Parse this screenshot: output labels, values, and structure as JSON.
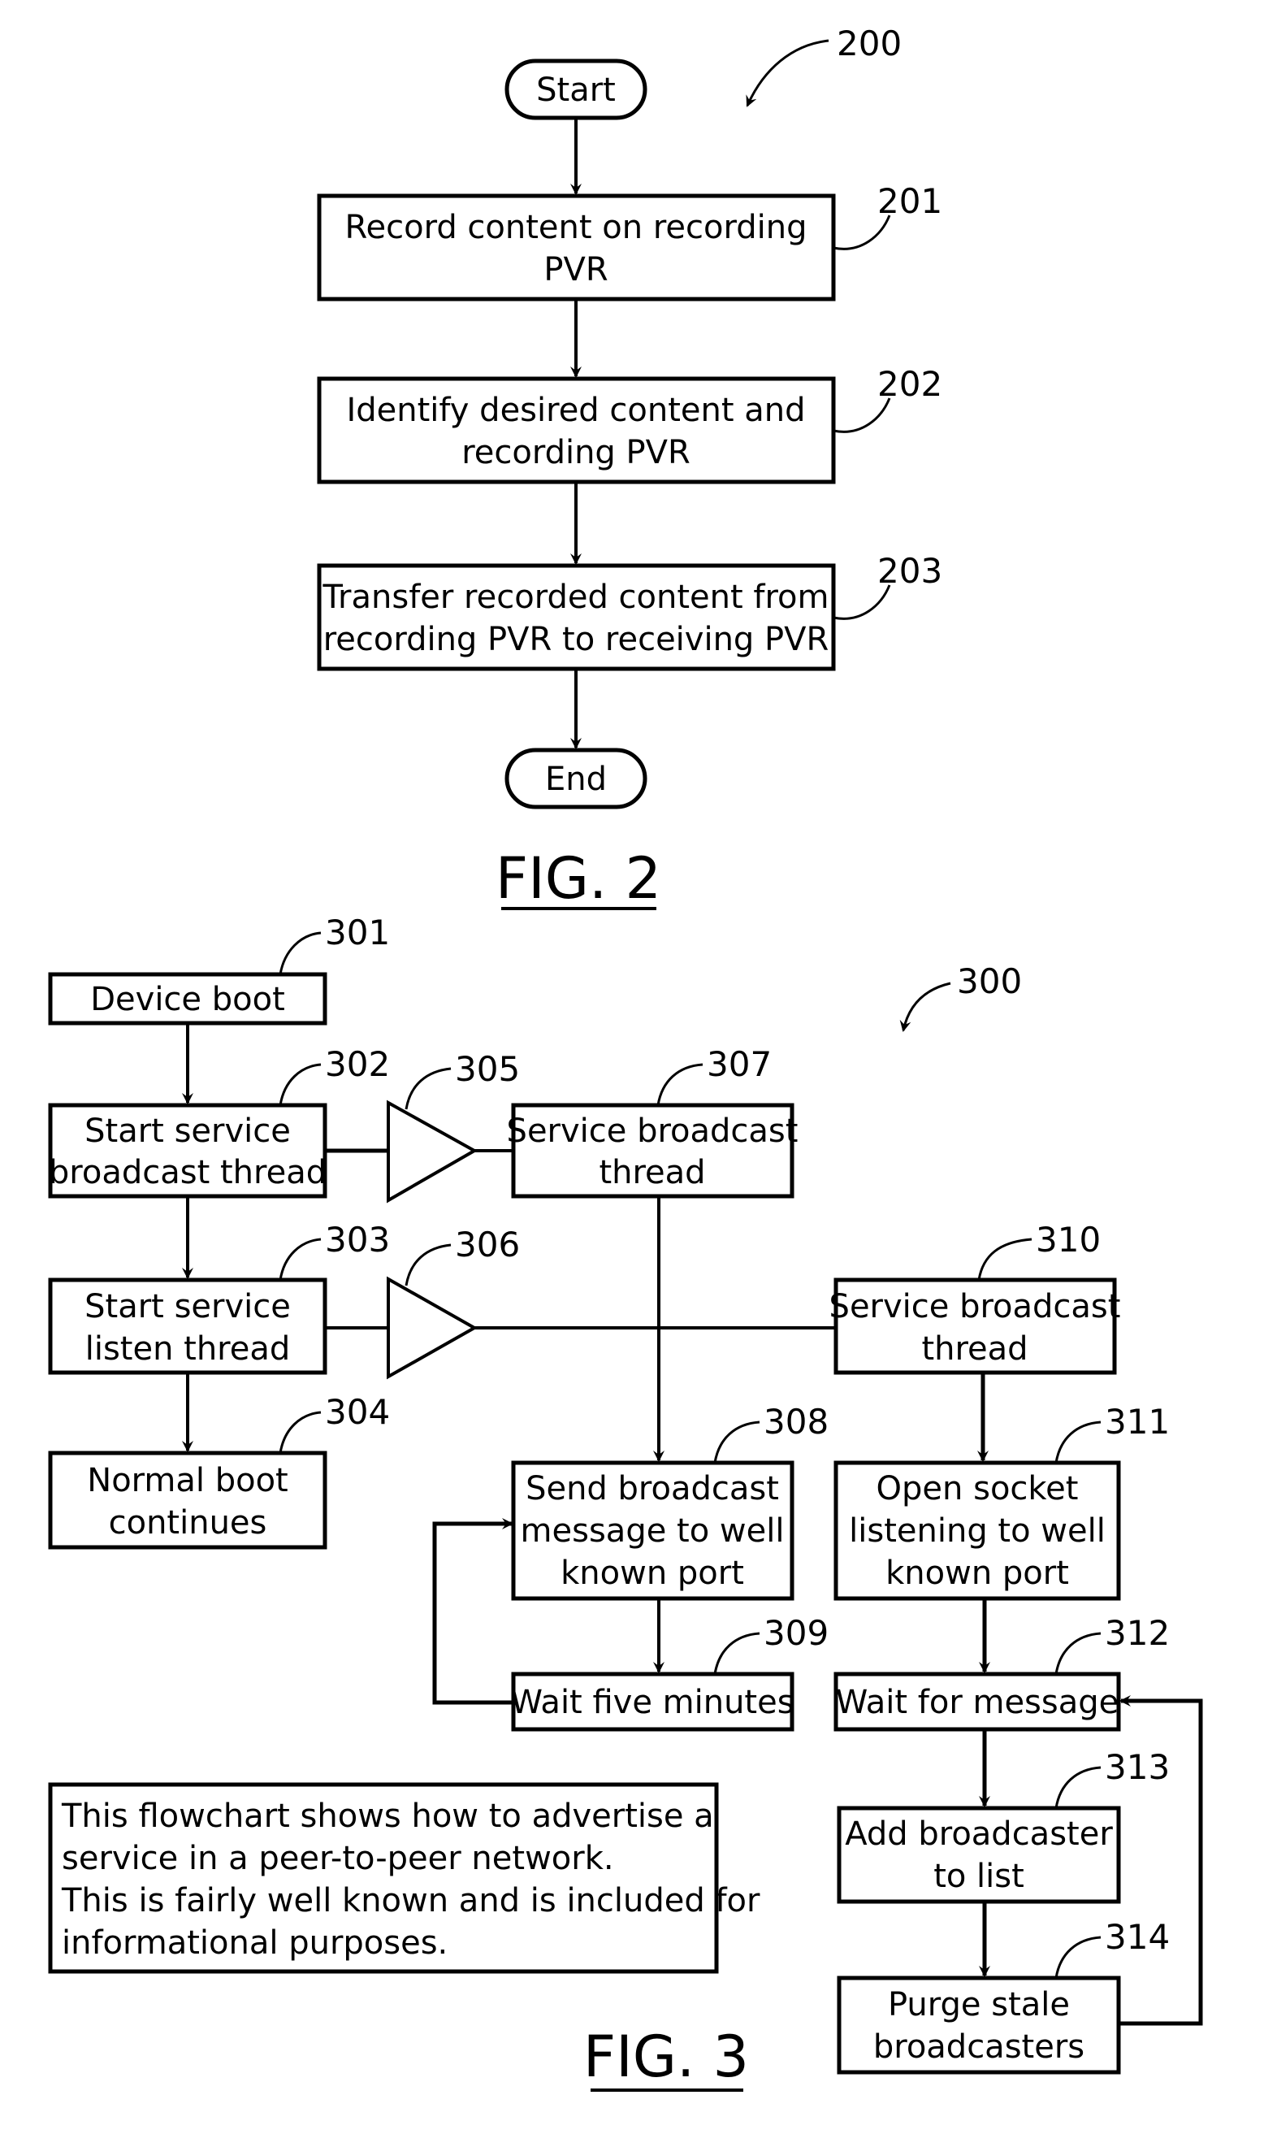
{
  "fig2": {
    "ref": "200",
    "caption": "FIG. 2",
    "start": "Start",
    "end": "End",
    "steps": [
      {
        "ref": "201",
        "lines": [
          "Record content on recording",
          "PVR"
        ]
      },
      {
        "ref": "202",
        "lines": [
          "Identify desired content and",
          "recording PVR"
        ]
      },
      {
        "ref": "203",
        "lines": [
          "Transfer recorded content from",
          "recording PVR to receiving PVR"
        ]
      }
    ]
  },
  "fig3": {
    "ref": "300",
    "caption": "FIG. 3",
    "nodes": {
      "n301": {
        "ref": "301",
        "lines": [
          "Device boot"
        ]
      },
      "n302": {
        "ref": "302",
        "lines": [
          "Start service",
          "broadcast thread"
        ]
      },
      "n303": {
        "ref": "303",
        "lines": [
          "Start service",
          "listen thread"
        ]
      },
      "n304": {
        "ref": "304",
        "lines": [
          "Normal boot",
          "continues"
        ]
      },
      "n305": {
        "ref": "305"
      },
      "n306": {
        "ref": "306"
      },
      "n307": {
        "ref": "307",
        "lines": [
          "Service broadcast",
          "thread"
        ]
      },
      "n308": {
        "ref": "308",
        "lines": [
          "Send broadcast",
          "message to well",
          "known port"
        ]
      },
      "n309": {
        "ref": "309",
        "lines": [
          "Wait five minutes"
        ]
      },
      "n310": {
        "ref": "310",
        "lines": [
          "Service broadcast",
          "thread"
        ]
      },
      "n311": {
        "ref": "311",
        "lines": [
          "Open socket",
          "listening to well",
          "known port"
        ]
      },
      "n312": {
        "ref": "312",
        "lines": [
          "Wait for message"
        ]
      },
      "n313": {
        "ref": "313",
        "lines": [
          "Add broadcaster",
          "to list"
        ]
      },
      "n314": {
        "ref": "314",
        "lines": [
          "Purge stale",
          "broadcasters"
        ]
      }
    },
    "note": [
      "This flowchart shows how to advertise a",
      "service in a peer-to-peer network.",
      "This is fairly well known and is included for",
      "informational purposes."
    ]
  }
}
